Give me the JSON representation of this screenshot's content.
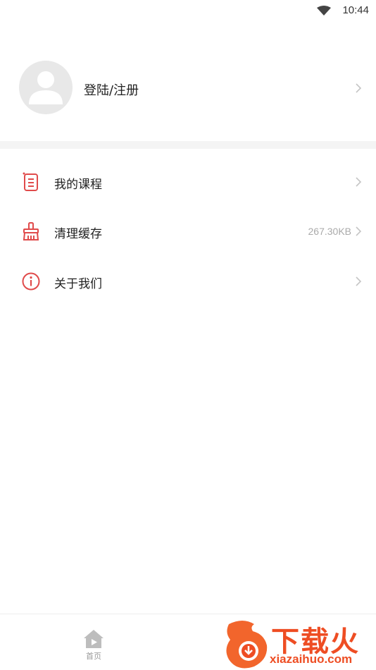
{
  "status_bar": {
    "time": "10:44",
    "wifi_icon": "wifi-icon"
  },
  "profile": {
    "login_label": "登陆/注册",
    "avatar_icon": "person-icon"
  },
  "menu": [
    {
      "label": "我的课程",
      "icon": "course-document-icon",
      "value": ""
    },
    {
      "label": "清理缓存",
      "icon": "broom-icon",
      "value": "267.30KB"
    },
    {
      "label": "关于我们",
      "icon": "info-icon",
      "value": ""
    }
  ],
  "tabbar": {
    "home_label": "首页",
    "home_icon": "home-play-icon"
  },
  "watermark": {
    "text_big": "下载火",
    "text_small": "xiazaihuo.com"
  },
  "colors": {
    "accent": "#e04b4b",
    "watermark": "#ee4d23",
    "divider": "#f4f4f4"
  }
}
